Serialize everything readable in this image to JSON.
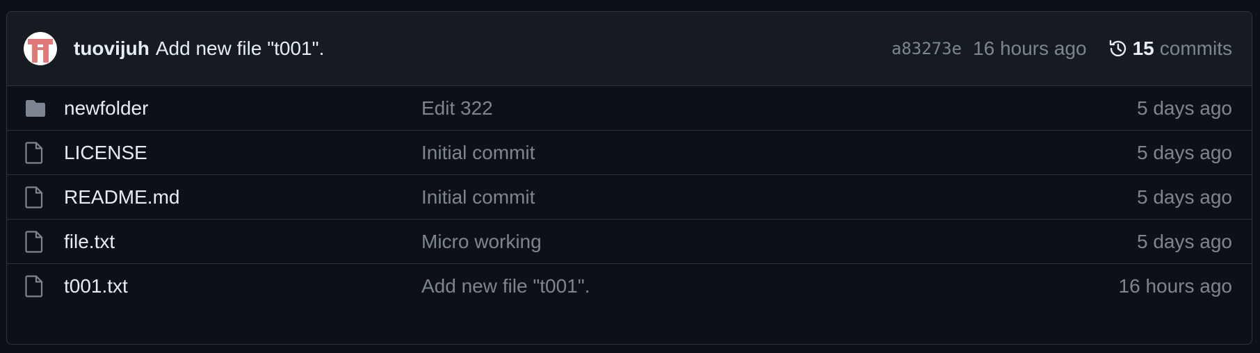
{
  "header": {
    "avatar": "avatar-identicon",
    "author": "tuovijuh",
    "message": "Add new file \"t001\".",
    "sha": "a83273e",
    "time": "16 hours ago",
    "commit_count": "15",
    "commit_label": "commits",
    "history_icon": "history-icon"
  },
  "files": [
    {
      "type": "folder",
      "icon": "folder-icon",
      "name": "newfolder",
      "message": "Edit 322",
      "date": "5 days ago"
    },
    {
      "type": "file",
      "icon": "file-icon",
      "name": "LICENSE",
      "message": "Initial commit",
      "date": "5 days ago"
    },
    {
      "type": "file",
      "icon": "file-icon",
      "name": "README.md",
      "message": "Initial commit",
      "date": "5 days ago"
    },
    {
      "type": "file",
      "icon": "file-icon",
      "name": "file.txt",
      "message": "Micro working",
      "date": "5 days ago"
    },
    {
      "type": "file",
      "icon": "file-icon",
      "name": "t001.txt",
      "message": "Add new file \"t001\".",
      "date": "16 hours ago"
    }
  ],
  "colors": {
    "background": "#0d1117",
    "header_background": "#161b22",
    "border": "#30363d",
    "muted_text": "#7d8590",
    "primary_text": "#e6edf3",
    "avatar_accent": "#e07a7a"
  }
}
